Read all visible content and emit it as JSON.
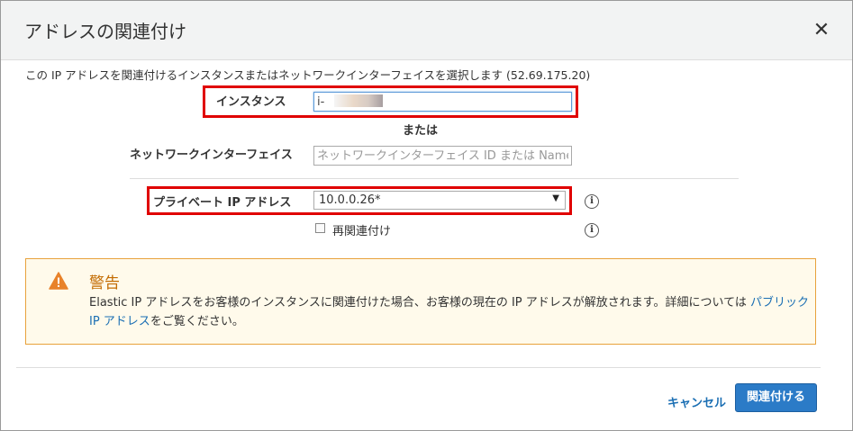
{
  "dialog": {
    "title": "アドレスの関連付け",
    "close_label": "✕",
    "intro": "この IP アドレスを関連付けるインスタンスまたはネットワークインターフェイスを選択します (52.69.175.20)"
  },
  "form": {
    "instance_label": "インスタンス",
    "instance_value": "i-",
    "or_label": "または",
    "network_interface_label": "ネットワークインターフェイス",
    "network_interface_placeholder": "ネットワークインターフェイス ID または Name タ",
    "private_ip_label": "プライベート IP アドレス",
    "private_ip_selected": "10.0.0.26*",
    "reassociate_label": "再関連付け",
    "reassociate_checked": false
  },
  "warning": {
    "title": "警告",
    "body": "Elastic IP アドレスをお客様のインスタンスに関連付けた場合、お客様の現在の IP アドレスが解放されます。詳細については ",
    "link_text": "パブリック IP アドレス",
    "body_suffix": "をご覧ください。"
  },
  "footer": {
    "cancel_label": "キャンセル",
    "submit_label": "関連付ける"
  },
  "colors": {
    "highlight": "#e00000",
    "link": "#1a6eb3",
    "primary_button": "#2b7bc7",
    "warning_border": "#e8a23c",
    "warning_title": "#c36b00"
  },
  "icons": {
    "close": "close-icon",
    "info": "info-icon",
    "warning": "warning-icon",
    "dropdown": "chevron-down-icon"
  }
}
